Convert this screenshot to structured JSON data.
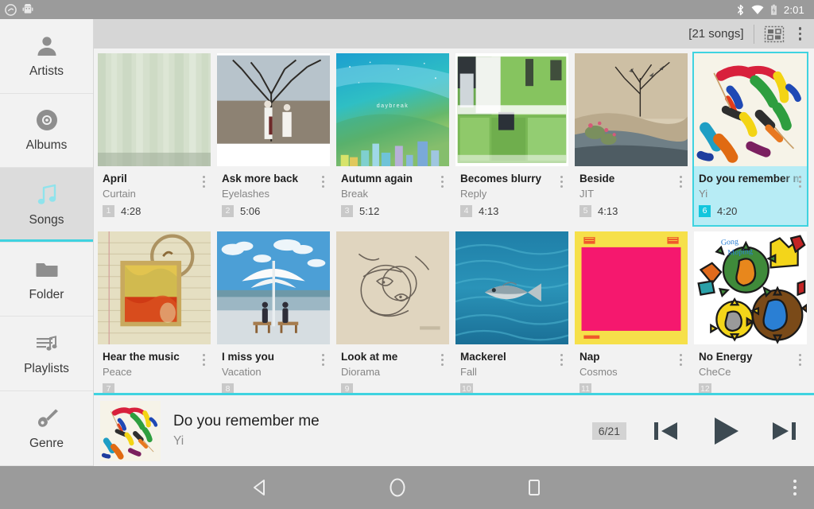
{
  "statusbar": {
    "time": "2:01",
    "icons": [
      "notification-circle-icon",
      "android-robot-icon",
      "bluetooth-icon",
      "wifi-icon",
      "battery-charging-icon"
    ]
  },
  "sidebar": {
    "items": [
      {
        "label": "Artists",
        "icon": "person-icon",
        "active": false
      },
      {
        "label": "Albums",
        "icon": "disc-icon",
        "active": false
      },
      {
        "label": "Songs",
        "icon": "music-note-icon",
        "active": true
      },
      {
        "label": "Folder",
        "icon": "folder-icon",
        "active": false
      },
      {
        "label": "Playlists",
        "icon": "playlist-icon",
        "active": false
      },
      {
        "label": "Genre",
        "icon": "guitar-icon",
        "active": false
      }
    ]
  },
  "toolbar": {
    "songs_count": "[21 songs]",
    "view_toggle_icon": "grid-view-icon",
    "overflow_icon": "overflow-menu-icon"
  },
  "songs": [
    {
      "title": "April",
      "artist": "Curtain",
      "track": "1",
      "duration": "4:28",
      "art": "curtain",
      "selected": false
    },
    {
      "title": "Ask more back",
      "artist": "Eyelashes",
      "track": "2",
      "duration": "5:06",
      "art": "tree",
      "selected": false
    },
    {
      "title": "Autumn again",
      "artist": "Break",
      "track": "3",
      "duration": "5:12",
      "art": "daybreak",
      "selected": false
    },
    {
      "title": "Becomes blurry",
      "artist": "Reply",
      "track": "4",
      "duration": "4:13",
      "art": "greenery",
      "selected": false
    },
    {
      "title": "Beside",
      "artist": "JIT",
      "track": "5",
      "duration": "4:13",
      "art": "collage",
      "selected": false
    },
    {
      "title": "Do you remember me",
      "artist": "Yi",
      "track": "6",
      "duration": "4:20",
      "art": "crayon",
      "selected": true
    },
    {
      "title": "Hear the music",
      "artist": "Peace",
      "track": "7",
      "duration": "",
      "art": "notebook",
      "selected": false
    },
    {
      "title": "I miss you",
      "artist": "Vacation",
      "track": "8",
      "duration": "",
      "art": "pier",
      "selected": false
    },
    {
      "title": "Look at me",
      "artist": "Diorama",
      "track": "9",
      "duration": "",
      "art": "sketch",
      "selected": false
    },
    {
      "title": "Mackerel",
      "artist": "Fall",
      "track": "10",
      "duration": "",
      "art": "fish",
      "selected": false
    },
    {
      "title": "Nap",
      "artist": "Cosmos",
      "track": "11",
      "duration": "",
      "art": "pink",
      "selected": false
    },
    {
      "title": "No Energy",
      "artist": "CheCe",
      "track": "12",
      "duration": "",
      "art": "gears",
      "selected": false
    }
  ],
  "now_playing": {
    "title": "Do you remember me",
    "artist": "Yi",
    "position": "6/21",
    "prev_icon": "skip-previous-icon",
    "play_icon": "play-icon",
    "next_icon": "skip-next-icon"
  },
  "navbar": {
    "back_icon": "back-triangle-icon",
    "home_icon": "home-circle-icon",
    "recents_icon": "recents-square-icon",
    "overflow_icon": "overflow-menu-icon"
  },
  "colors": {
    "accent": "#3fd3e0",
    "accent_badge": "#12c6dd",
    "selected_bg": "#b7ecf5",
    "panel_bg": "#f2f2f2",
    "toolbar_bg": "#d6d6d6",
    "system_bar": "#9b9b9b",
    "control": "#3d4a52"
  }
}
